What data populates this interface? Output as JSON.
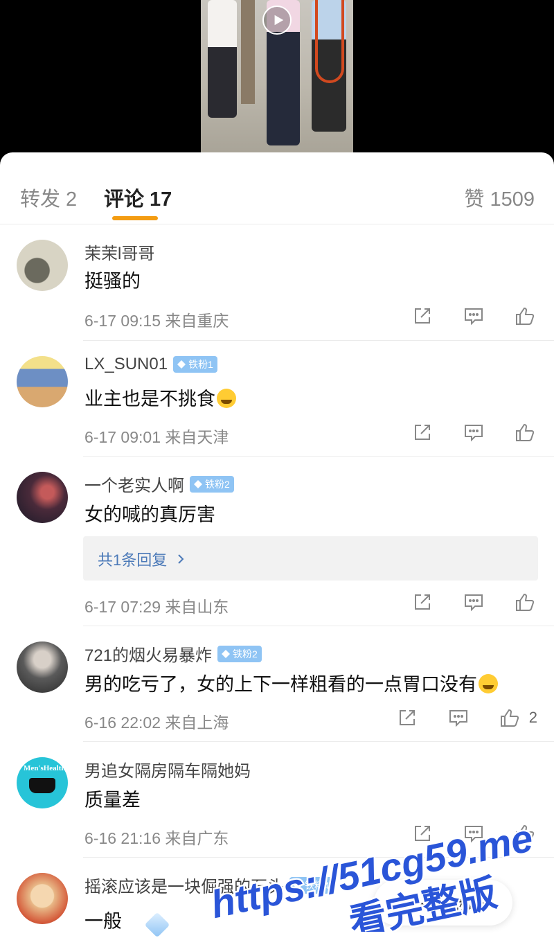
{
  "tabs": {
    "repost": "转发 2",
    "comments": "评论 17",
    "likes": "赞 1509"
  },
  "comments": [
    {
      "name": "茉茉l哥哥",
      "badge": "",
      "text": "挺骚的",
      "meta": "6-17 09:15 来自重庆",
      "like_count": "",
      "avatar_color": "#d8d4c4"
    },
    {
      "name": "LX_SUN01",
      "badge": "铁粉1",
      "text": "业主也是不挑食",
      "meta": "6-17 09:01 来自天津",
      "like_count": "",
      "avatar_color": "#6d8fc4"
    },
    {
      "name": "一个老实人啊",
      "badge": "铁粉2",
      "text": "女的喊的真厉害",
      "reply_summary": "共1条回复",
      "meta": "6-17 07:29 来自山东",
      "like_count": "",
      "avatar_color": "#4a2a3a"
    },
    {
      "name": "721的烟火易暴炸",
      "badge": "铁粉2",
      "text": "男的吃亏了，女的上下一样粗看的一点胃口没有",
      "meta": "6-16 22:02 来自上海",
      "like_count": "2",
      "avatar_color": "#5a5a5a"
    },
    {
      "name": "男追女隔房隔车隔她妈",
      "badge": "",
      "text": "质量差",
      "meta": "6-16 21:16 来自广东",
      "like_count": "",
      "avatar_color": "#27c4d8",
      "avatar_text": "Men'sHealth"
    },
    {
      "name": "摇滚应该是一块倔强的石头",
      "badge": "铁粉4",
      "text": "一般",
      "meta": "",
      "like_count": "",
      "avatar_color": "#e8b887"
    }
  ],
  "next_video": "下一个视频",
  "watermark": {
    "line1": "https://51cg59.me",
    "line2": "看完整版",
    "color": "#2a55d8"
  },
  "colors": {
    "accent": "#f39c12",
    "link": "#4b79b8",
    "badge": "#8fc4f4"
  }
}
